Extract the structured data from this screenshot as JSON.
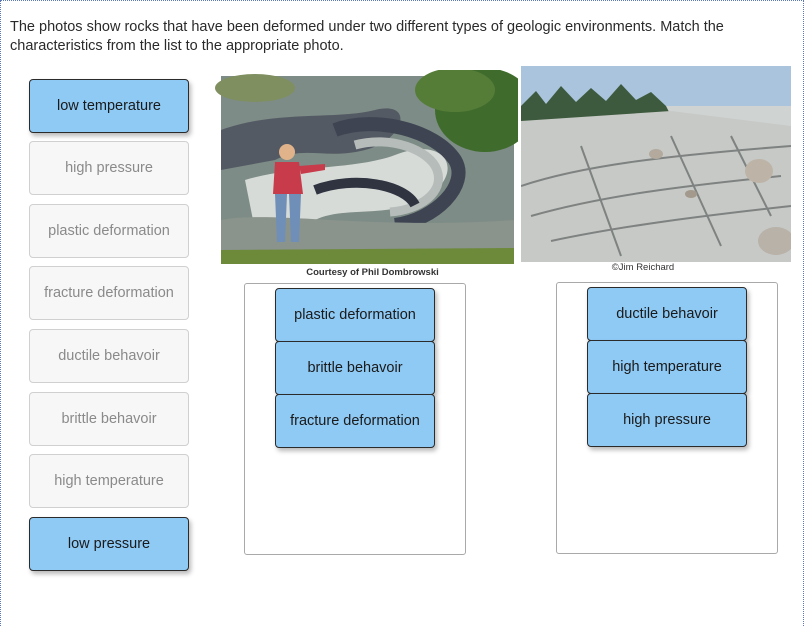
{
  "instructions": "The photos show rocks that have been deformed under two different types of geologic environments. Match the characteristics from the list to the appropriate photo.",
  "source_list": [
    {
      "label": "low temperature",
      "state": "filled"
    },
    {
      "label": "high pressure",
      "state": "empty"
    },
    {
      "label": "plastic deformation",
      "state": "empty"
    },
    {
      "label": "fracture deformation",
      "state": "empty"
    },
    {
      "label": "ductile behavoir",
      "state": "empty"
    },
    {
      "label": "brittle behavoir",
      "state": "empty"
    },
    {
      "label": "high temperature",
      "state": "empty"
    },
    {
      "label": "low pressure",
      "state": "filled"
    }
  ],
  "photos": {
    "left": {
      "caption": "Courtesy of Phil Dombrowski"
    },
    "right": {
      "caption": "©Jim Reichard"
    }
  },
  "dropzones": {
    "left": [
      "plastic deformation",
      "brittle behavoir",
      "fracture deformation"
    ],
    "right": [
      "ductile behavoir",
      "high temperature",
      "high pressure"
    ]
  },
  "colors": {
    "chip_fill": "#8fcaf5",
    "chip_empty": "#f7f7f7",
    "frame_dotted": "#5a78b8"
  }
}
